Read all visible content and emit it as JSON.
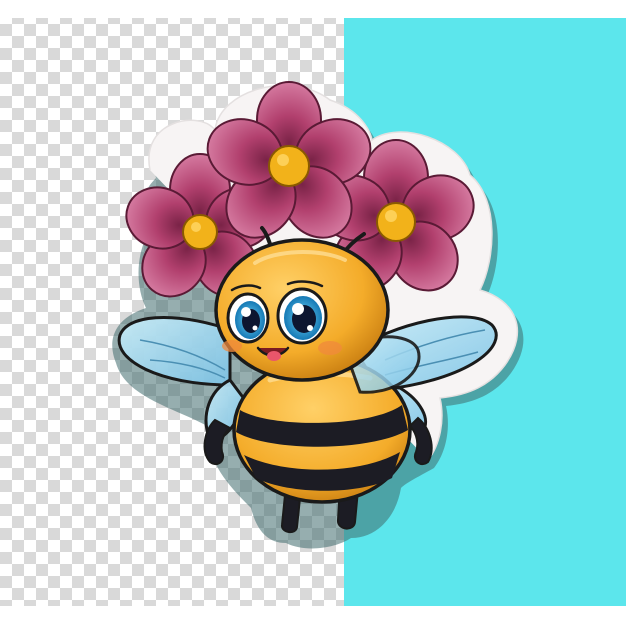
{
  "scene": {
    "subject": "bee-sticker",
    "colors": {
      "page_background": "#ffffff",
      "checker_light": "#ffffff",
      "checker_dark": "#d9d9d9",
      "cyan_panel": "#5ce6ec",
      "sticker_border": "#f7f4f4",
      "sticker_shadow": "#3f6b6e",
      "petal": "#b2406e",
      "petal_dark": "#7a2347",
      "petal_highlight": "#d57aa0",
      "flower_center": "#f2b21a",
      "bee_yellow": "#f4ac2a",
      "bee_yellow_light": "#ffd067",
      "bee_stripe": "#1c1c24",
      "outline": "#1a1a1a",
      "eye_iris": "#27a6d9",
      "eye_pupil": "#0d1630",
      "wing": "#7cc3e6",
      "wing_light": "#c9ecf7",
      "cheek": "#f08a3c",
      "tongue": "#e9566b"
    }
  }
}
